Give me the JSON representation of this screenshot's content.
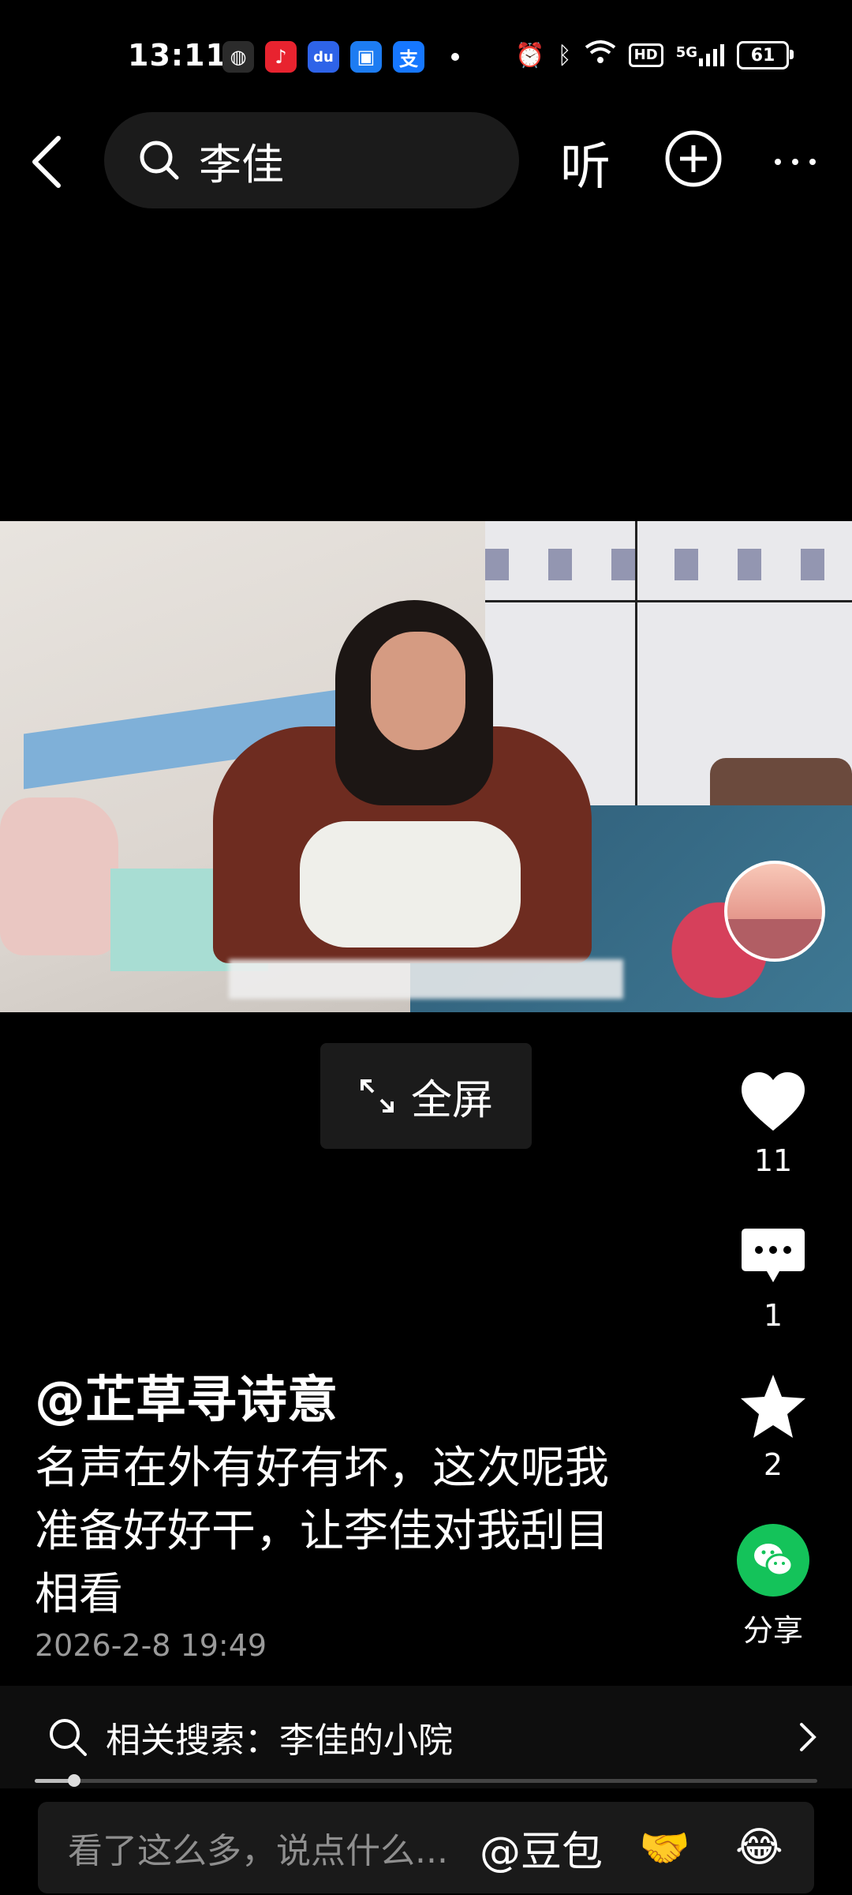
{
  "status_bar": {
    "time": "13:11",
    "network": "5G",
    "hd": "HD",
    "battery": "61",
    "apps": [
      {
        "name": "wechat-icon",
        "color": "#2b2b2b",
        "glyph": "◍"
      },
      {
        "name": "music-icon",
        "color": "#e8232f",
        "glyph": "♪"
      },
      {
        "name": "baidu-icon",
        "color": "#2e63e8",
        "glyph": "du"
      },
      {
        "name": "blue-bag-icon",
        "color": "#1d7cf2",
        "glyph": "▣"
      },
      {
        "name": "alipay-icon",
        "color": "#1677ff",
        "glyph": "支"
      }
    ]
  },
  "header": {
    "search_query": "李佳",
    "listen_label": "听"
  },
  "video": {
    "fullscreen_label": "全屏"
  },
  "actions": {
    "likes": "11",
    "comments": "1",
    "favorites": "2",
    "share_label": "分享",
    "share_color": "#14c35a"
  },
  "post": {
    "author": "@芷草寻诗意",
    "caption": "名声在外有好有坏，这次呢我准备好好干，让李佳对我刮目相看",
    "time": "2026-2-8 19:49"
  },
  "related_search": {
    "label": "相关搜索：李佳的小院"
  },
  "video_progress": 0.05,
  "comment_bar": {
    "placeholder": "看了这么多，说点什么...",
    "mention": "@豆包",
    "emojis": [
      "🤝",
      "😂"
    ]
  }
}
